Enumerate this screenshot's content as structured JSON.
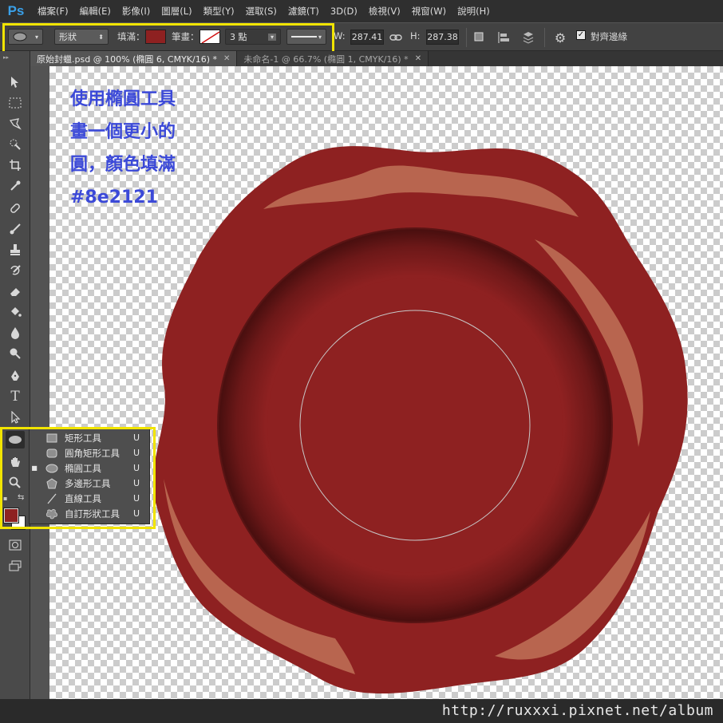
{
  "app": {
    "logo": "Ps"
  },
  "menu": [
    "檔案(F)",
    "編輯(E)",
    "影像(I)",
    "圖層(L)",
    "類型(Y)",
    "選取(S)",
    "濾鏡(T)",
    "3D(D)",
    "檢視(V)",
    "視窗(W)",
    "說明(H)"
  ],
  "options": {
    "mode": "形狀",
    "fill_label": "填滿：",
    "fill_color": "#8e2121",
    "stroke_label": "筆畫：",
    "stroke_size": "3 點",
    "w_label": "W:",
    "w_value": "287.41",
    "h_label": "H:",
    "h_value": "287.38",
    "align_edges_label": "對齊邊緣",
    "align_edges_checked": true
  },
  "tabs": [
    {
      "label": "原始封蠟.psd @ 100% (橢圓 6, CMYK/16) *",
      "active": true
    },
    {
      "label": "未命名-1 @ 66.7% (橢圓 1, CMYK/16) *",
      "active": false
    }
  ],
  "toolbar": {
    "foreground_color": "#8e2121",
    "background_color": "#ffffff",
    "selected_tool": "ellipse-tool"
  },
  "annotation": {
    "lines": [
      "使用橢圓工具",
      "畫一個更小的",
      "圓，顏色填滿",
      "#8e2121"
    ],
    "color": "#3b49d8"
  },
  "flyout": [
    {
      "label": "矩形工具",
      "key": "U",
      "icon": "rectangle-icon",
      "active": false
    },
    {
      "label": "圓角矩形工具",
      "key": "U",
      "icon": "rounded-rectangle-icon",
      "active": false
    },
    {
      "label": "橢圓工具",
      "key": "U",
      "icon": "ellipse-icon",
      "active": true
    },
    {
      "label": "多邊形工具",
      "key": "U",
      "icon": "polygon-icon",
      "active": false
    },
    {
      "label": "直線工具",
      "key": "U",
      "icon": "line-icon",
      "active": false
    },
    {
      "label": "自訂形狀工具",
      "key": "U",
      "icon": "custom-shape-icon",
      "active": false
    }
  ],
  "colors": {
    "seal": "#8e2121",
    "seal_highlight": "#b8654f",
    "highlight_frame": "#f1e400"
  },
  "watermark": "http://ruxxxi.pixnet.net/album"
}
